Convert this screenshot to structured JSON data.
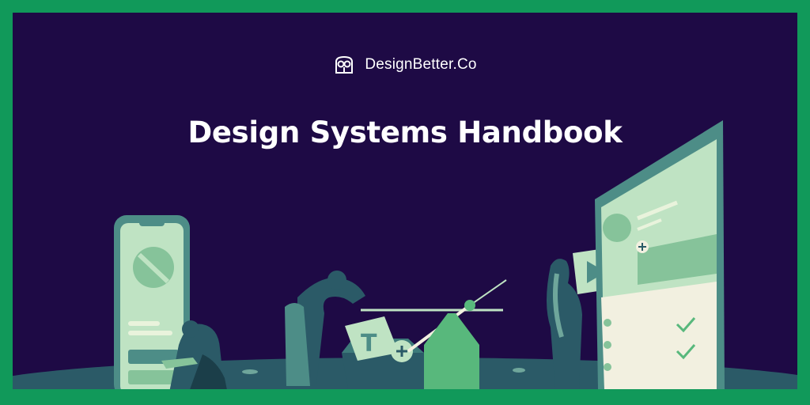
{
  "brand": {
    "name": "DesignBetter.Co",
    "logo_icon": "owl-logo-icon"
  },
  "title": "Design Systems Handbook",
  "colors": {
    "border": "#11995a",
    "background": "#1e0a45",
    "mint": "#bfe3c3",
    "teal": "#4d8d87",
    "green": "#58b87c",
    "cream": "#f2f0e0"
  }
}
